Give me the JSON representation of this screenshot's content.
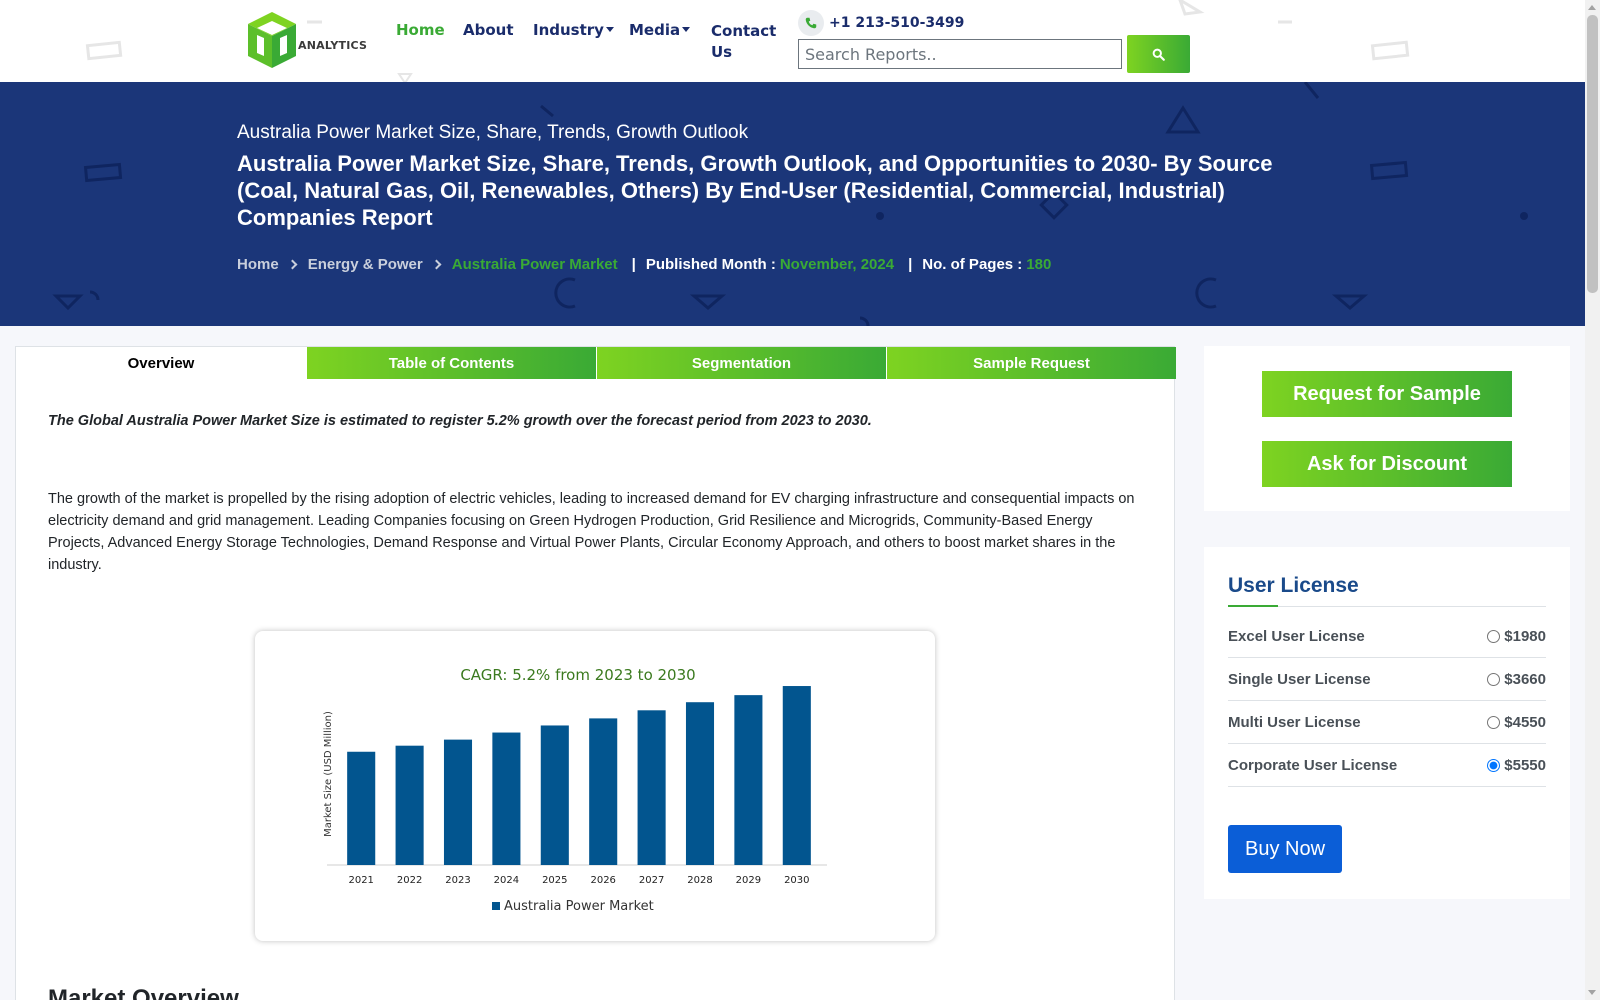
{
  "brand": {
    "logo_text": "ANALYTICS"
  },
  "nav": {
    "home": "Home",
    "about": "About",
    "industry": "Industry",
    "media": "Media",
    "contact": "Contact Us"
  },
  "contact": {
    "phone": "+1 213-510-3499"
  },
  "search": {
    "placeholder": "Search Reports..",
    "button_icon": "search-icon"
  },
  "banner": {
    "subtitle": "Australia Power Market Size, Share, Trends, Growth Outlook",
    "title": "Australia Power Market Size, Share, Trends, Growth Outlook, and Opportunities to 2030- By Source (Coal, Natural Gas, Oil, Renewables, Others) By End-User (Residential, Commercial, Industrial) Companies Report",
    "breadcrumb": [
      "Home",
      "Energy & Power",
      "Australia Power Market"
    ],
    "published_label": "Published Month :",
    "published_value": "November, 2024",
    "pages_label": "No. of Pages :",
    "pages_value": "180"
  },
  "tabs": [
    "Overview",
    "Table of Contents",
    "Segmentation",
    "Sample Request"
  ],
  "content": {
    "lead": "The Global Australia Power Market Size is estimated to register 5.2% growth over the forecast period from 2023 to 2030.",
    "paragraph": "The growth of the market is propelled by the rising adoption of electric vehicles, leading to increased demand for EV charging infrastructure and consequential impacts on electricity demand and grid management. Leading Companies focusing on Green Hydrogen Production, Grid Resilience and Microgrids, Community-Based Energy Projects, Advanced Energy Storage Technologies, Demand Response and Virtual Power Plants, Circular Economy Approach, and others to boost market shares in the industry.",
    "section_title": "Market Overview"
  },
  "chart_data": {
    "type": "bar",
    "title": "CAGR: 5.2% from 2023 to 2030",
    "ylabel": "Market Size (USD Million)",
    "xlabel": "",
    "categories": [
      "2021",
      "2022",
      "2023",
      "2024",
      "2025",
      "2026",
      "2027",
      "2028",
      "2029",
      "2030"
    ],
    "series": [
      {
        "name": "Australia Power Market",
        "values": [
          112,
          118,
          124,
          131,
          138,
          145,
          153,
          161,
          168,
          177
        ],
        "color": "#02558f"
      }
    ],
    "ylim": [
      0,
      180
    ],
    "grid": false,
    "legend": "bottom",
    "title_color": "#3b7a1f"
  },
  "sidebar": {
    "request_sample": "Request for Sample",
    "ask_discount": "Ask for Discount",
    "license_title": "User License",
    "licenses": [
      {
        "name": "Excel User License",
        "price": "$1980",
        "selected": false
      },
      {
        "name": "Single User License",
        "price": "$3660",
        "selected": false
      },
      {
        "name": "Multi User License",
        "price": "$4550",
        "selected": false
      },
      {
        "name": "Corporate User License",
        "price": "$5550",
        "selected": true
      }
    ],
    "buy_now": "Buy Now"
  },
  "colors": {
    "brand_green": "#3aaa35",
    "light_green": "#7ed321",
    "navy": "#1b3679",
    "nav_text": "#1a2c6b",
    "buy_blue": "#0b5ed7"
  }
}
